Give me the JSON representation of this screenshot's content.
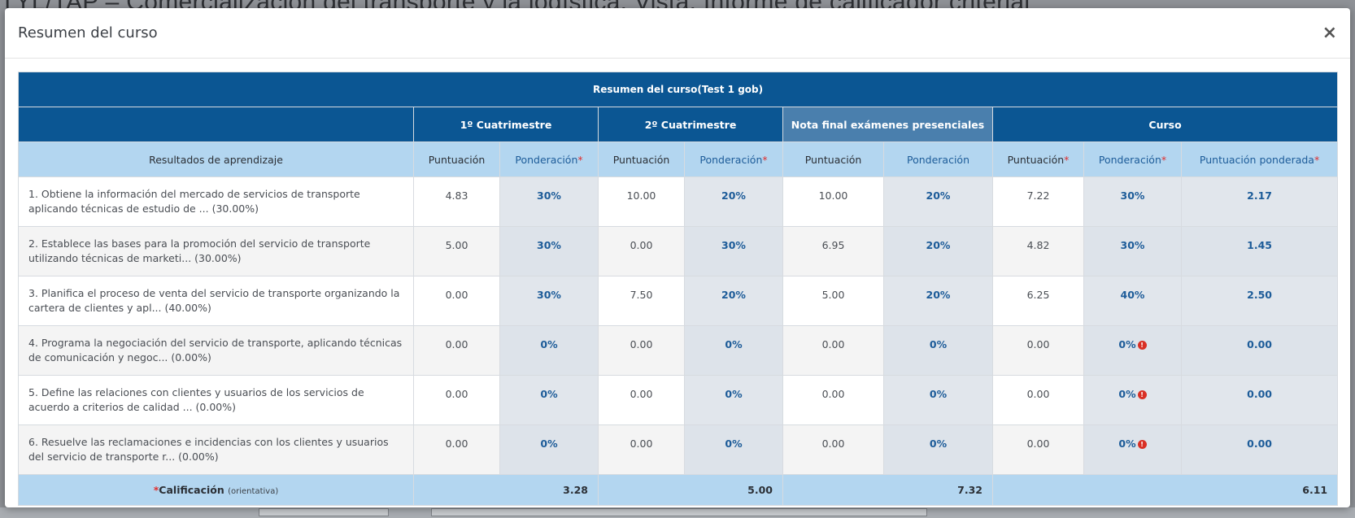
{
  "background": {
    "title": "TYL/TAP – Comercialización del transporte y la logística: Vista: Informe de calificador criterial"
  },
  "modal": {
    "title": "Resumen del curso",
    "close_label": "×"
  },
  "table": {
    "title": "Resumen del curso(Test 1 gob)",
    "groups": {
      "q1": "1º Cuatrimestre",
      "q2": "2º Cuatrimestre",
      "final": "Nota final exámenes presenciales",
      "course": "Curso"
    },
    "columns": {
      "learning": "Resultados de aprendizaje",
      "score": "Puntuación",
      "weight": "Ponderación",
      "weighted": "Puntuación ponderada",
      "required_mark": "*"
    },
    "rows": [
      {
        "desc": "1. Obtiene la información del mercado de servicios de transporte aplicando técnicas de estudio de ... (30.00%)",
        "q1_score": "4.83",
        "q1_weight": "30%",
        "q2_score": "10.00",
        "q2_weight": "20%",
        "final_score": "10.00",
        "final_weight": "20%",
        "course_score": "7.22",
        "course_weight": "30%",
        "weighted": "2.17",
        "warn": false
      },
      {
        "desc": "2. Establece las bases para la promoción del servicio de transporte utilizando técnicas de marketi... (30.00%)",
        "q1_score": "5.00",
        "q1_weight": "30%",
        "q2_score": "0.00",
        "q2_weight": "30%",
        "final_score": "6.95",
        "final_weight": "20%",
        "course_score": "4.82",
        "course_weight": "30%",
        "weighted": "1.45",
        "warn": false
      },
      {
        "desc": "3. Planifica el proceso de venta del servicio de transporte organizando la cartera de clientes y apl... (40.00%)",
        "q1_score": "0.00",
        "q1_weight": "30%",
        "q2_score": "7.50",
        "q2_weight": "20%",
        "final_score": "5.00",
        "final_weight": "20%",
        "course_score": "6.25",
        "course_weight": "40%",
        "weighted": "2.50",
        "warn": false
      },
      {
        "desc": "4. Programa la negociación del servicio de transporte, aplicando técnicas de comunicación y negoc... (0.00%)",
        "q1_score": "0.00",
        "q1_weight": "0%",
        "q2_score": "0.00",
        "q2_weight": "0%",
        "final_score": "0.00",
        "final_weight": "0%",
        "course_score": "0.00",
        "course_weight": "0%",
        "weighted": "0.00",
        "warn": true
      },
      {
        "desc": "5. Define las relaciones con clientes y usuarios de los servicios de acuerdo a criterios de calidad ... (0.00%)",
        "q1_score": "0.00",
        "q1_weight": "0%",
        "q2_score": "0.00",
        "q2_weight": "0%",
        "final_score": "0.00",
        "final_weight": "0%",
        "course_score": "0.00",
        "course_weight": "0%",
        "weighted": "0.00",
        "warn": true
      },
      {
        "desc": "6. Resuelve las reclamaciones e incidencias con los clientes y usuarios del servicio de transporte r... (0.00%)",
        "q1_score": "0.00",
        "q1_weight": "0%",
        "q2_score": "0.00",
        "q2_weight": "0%",
        "final_score": "0.00",
        "final_weight": "0%",
        "course_score": "0.00",
        "course_weight": "0%",
        "weighted": "0.00",
        "warn": true
      }
    ],
    "final_row": {
      "label": "Calificación",
      "label_note": "(orientativa)",
      "q1": "3.28",
      "q2": "5.00",
      "final": "7.32",
      "course": "6.11"
    }
  },
  "colors": {
    "header_dark": "#0b5693",
    "header_alt": "#4a7fad",
    "header_light": "#b3d6f0",
    "weight_text": "#1d5c99",
    "warning": "#d93025"
  }
}
